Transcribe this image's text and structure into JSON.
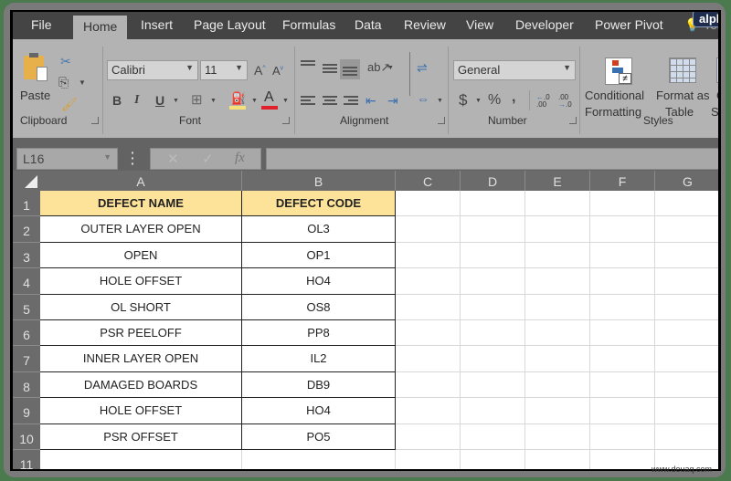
{
  "tabs": {
    "items": [
      "File",
      "Home",
      "Insert",
      "Page Layout",
      "Formulas",
      "Data",
      "Review",
      "View",
      "Developer",
      "Power Pivot"
    ],
    "active": "Home",
    "tell_label": "Tell"
  },
  "badge": "alphr",
  "ribbon": {
    "clipboard": {
      "paste_label": "Paste",
      "group_label": "Clipboard"
    },
    "font": {
      "font_name": "Calibri",
      "font_size": "11",
      "bold": "B",
      "italic": "I",
      "underline": "U",
      "group_label": "Font",
      "font_color": "#e0202a",
      "fill_color": "#f5e07a"
    },
    "alignment": {
      "group_label": "Alignment"
    },
    "number": {
      "format": "General",
      "currency": "$",
      "percent": "%",
      "comma": ",",
      "inc_decimal": ".00",
      "dec_decimal": ".0",
      "group_label": "Number"
    },
    "styles": {
      "conditional_1": "Conditional",
      "conditional_2": "Formatting",
      "format_table_1": "Format as",
      "format_table_2": "Table",
      "cell_styles_1": "C",
      "cell_styles_2": "Styl",
      "group_label": "Styles"
    }
  },
  "formula_bar": {
    "name_box": "L16",
    "cancel": "✕",
    "enter": "✓",
    "fx": "fx",
    "value": ""
  },
  "sheet": {
    "columns": [
      "A",
      "B",
      "C",
      "D",
      "E",
      "F",
      "G"
    ],
    "rows": [
      "1",
      "2",
      "3",
      "4",
      "5",
      "6",
      "7",
      "8",
      "9",
      "10",
      "11"
    ],
    "header": [
      "DEFECT NAME",
      "DEFECT CODE"
    ],
    "header_fill": "#fde29a",
    "data": [
      [
        "OUTER LAYER OPEN",
        "OL3"
      ],
      [
        "OPEN",
        "OP1"
      ],
      [
        "HOLE OFFSET",
        "HO4"
      ],
      [
        "OL SHORT",
        "OS8"
      ],
      [
        "PSR PEELOFF",
        "PP8"
      ],
      [
        "INNER LAYER OPEN",
        "IL2"
      ],
      [
        "DAMAGED BOARDS",
        "DB9"
      ],
      [
        "HOLE OFFSET",
        "HO4"
      ],
      [
        "PSR OFFSET",
        "PO5"
      ]
    ]
  },
  "watermark": "www.deuaq.com"
}
